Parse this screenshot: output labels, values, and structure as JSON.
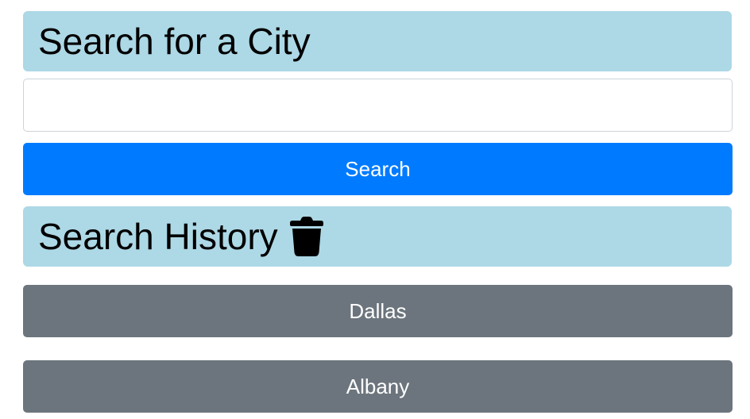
{
  "search_section": {
    "title": "Search for a City",
    "input_value": "",
    "input_placeholder": "",
    "button_label": "Search"
  },
  "history_section": {
    "title": "Search History",
    "clear_icon": "trash-icon",
    "items": [
      {
        "label": "Dallas"
      },
      {
        "label": "Albany"
      }
    ]
  },
  "colors": {
    "header_bg": "#add8e6",
    "primary_button": "#007bff",
    "history_button": "#6c757d"
  }
}
